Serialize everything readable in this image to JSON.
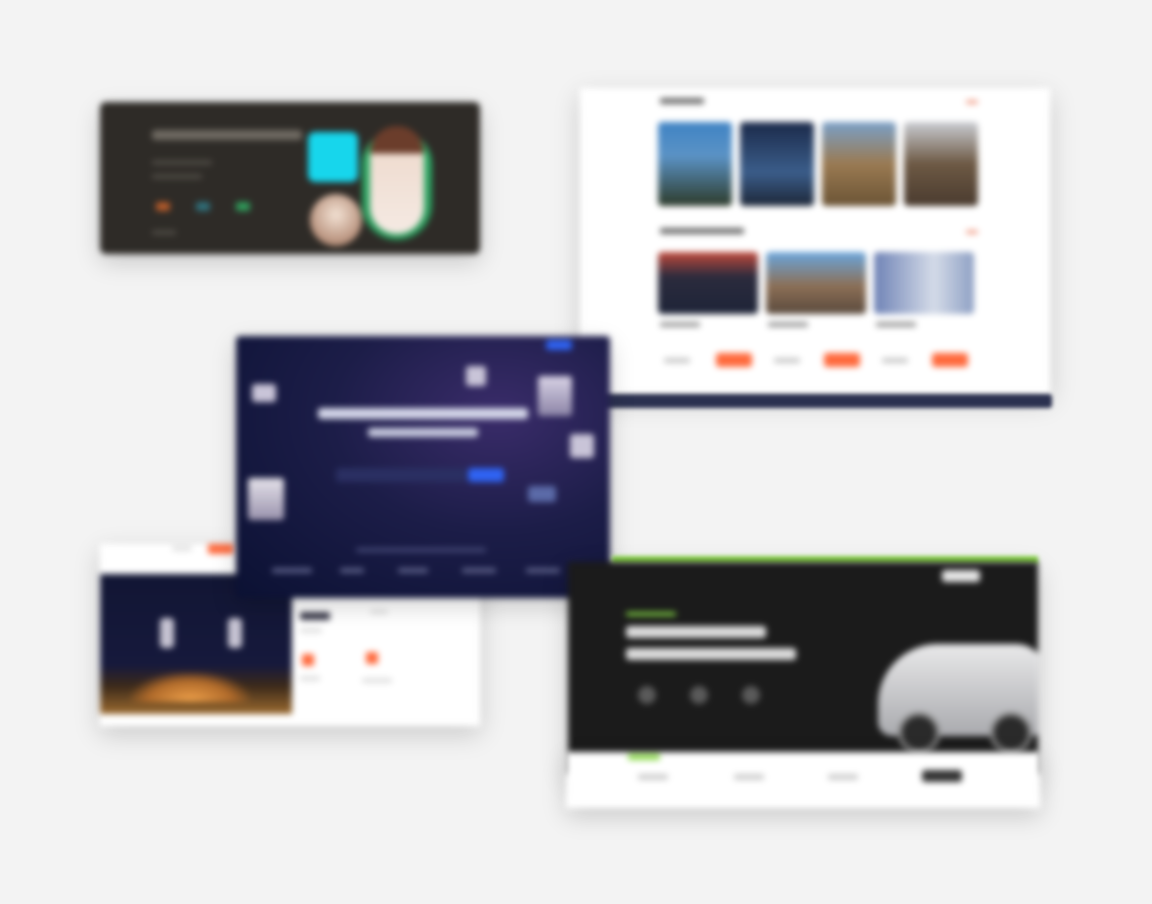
{
  "page": {
    "background": "#f3f3f3",
    "note_visible_text": ""
  },
  "cards": {
    "team": {
      "accent": "#17d6ec",
      "ring": "#2fb06a"
    },
    "real_estate": {
      "accent": "#ff6a3d",
      "sections": 2,
      "buildings_row1": 4,
      "buildings_row2": 3
    },
    "crypto": {
      "accent": "#2f63f3"
    },
    "night_event": {
      "accent": "#ff6a3d"
    },
    "car_dealer": {
      "accent": "#8bd94a"
    }
  }
}
